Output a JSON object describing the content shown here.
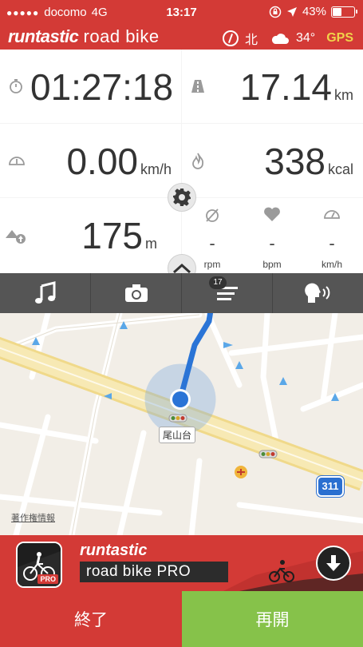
{
  "status": {
    "carrier": "docomo",
    "network": "4G",
    "time": "13:17",
    "battery_percent": "43%",
    "battery_level": 0.43
  },
  "header": {
    "brand_bold": "runtastic",
    "brand_light": "road bike",
    "compass": "北",
    "temperature": "34°",
    "gps": "GPS"
  },
  "stats": {
    "duration": "01:27:18",
    "distance": {
      "value": "17.14",
      "unit": "km"
    },
    "speed": {
      "value": "0.00",
      "unit": "km/h"
    },
    "calories": {
      "value": "338",
      "unit": "kcal"
    },
    "elevation": {
      "value": "175",
      "unit": "m"
    },
    "cadence": {
      "value": "-",
      "label": "rpm"
    },
    "heart_rate": {
      "value": "-",
      "label": "bpm"
    },
    "pace": {
      "value": "-",
      "label": "km/h"
    }
  },
  "map": {
    "place_label": "尾山台",
    "route_number": "311",
    "route_badge": "17",
    "copyright": "著作権情報"
  },
  "ad": {
    "brand": "runtastic",
    "product": "road bike PRO",
    "pro_badge": "PRO"
  },
  "actions": {
    "end": "終了",
    "resume": "再開"
  },
  "colors": {
    "brand_red": "#d33a36",
    "resume_green": "#86c24a",
    "gps_yellow": "#f0d24a",
    "route_blue": "#2a74d6"
  }
}
